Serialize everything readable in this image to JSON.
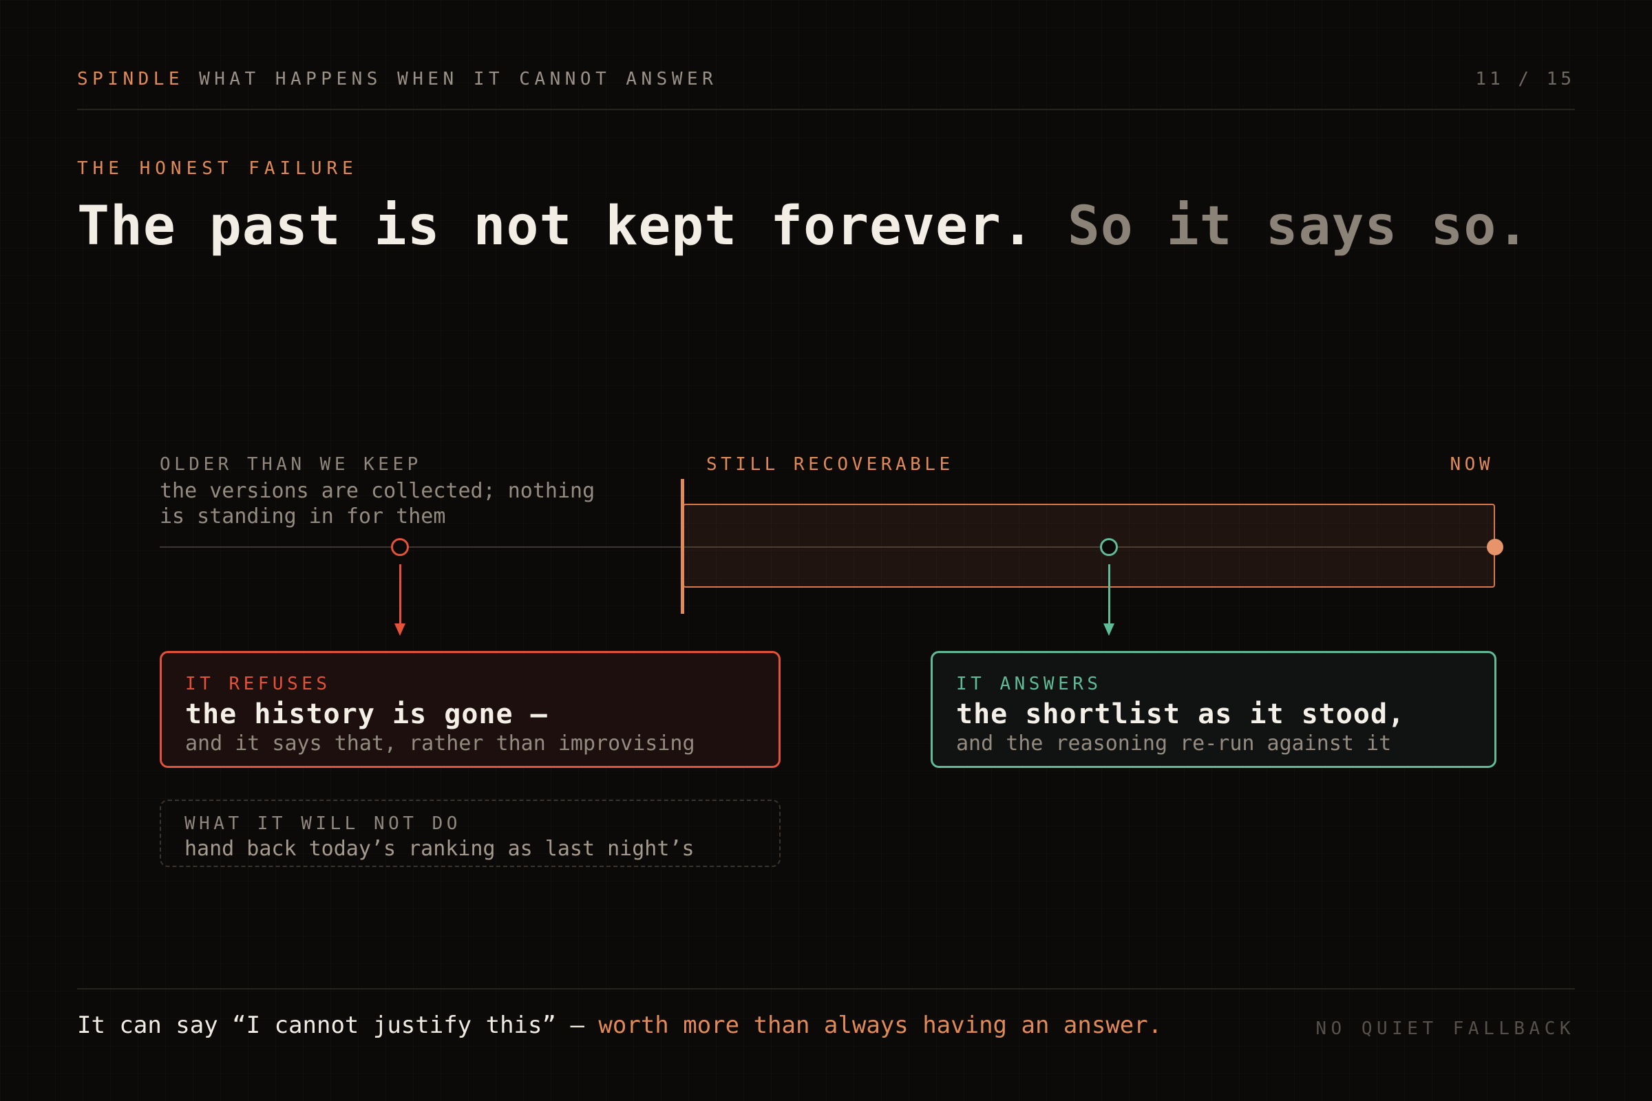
{
  "header": {
    "brand": "SPINDLE",
    "section": "WHAT HAPPENS WHEN IT CANNOT ANSWER",
    "page": "11 / 15"
  },
  "eyebrow": "THE HONEST FAILURE",
  "headline": {
    "primary": "The past is not kept forever.",
    "secondary": "So it says so."
  },
  "timeline": {
    "old_label": "OLDER THAN WE KEEP",
    "old_desc_line1": "the versions are collected; nothing",
    "old_desc_line2": "is standing in for them",
    "recoverable_label": "STILL RECOVERABLE",
    "now_label": "NOW"
  },
  "refuse_card": {
    "tag": "IT REFUSES",
    "title": "the history is gone —",
    "sub": "and it says that, rather than improvising"
  },
  "answer_card": {
    "tag": "IT ANSWERS",
    "title": "the shortlist as it stood,",
    "sub": "and the reasoning re-run against it"
  },
  "not_card": {
    "tag": "WHAT IT WILL NOT DO",
    "body": "hand back today’s ranking as last night’s"
  },
  "footer": {
    "quote": "It can say “I cannot justify this” —",
    "accent": "worth more than always having an answer.",
    "note": "NO QUIET FALLBACK"
  },
  "colors": {
    "accent": "#e08a58",
    "refuse": "#e5523a",
    "answer": "#5fbb98",
    "background": "#0b0a09"
  }
}
